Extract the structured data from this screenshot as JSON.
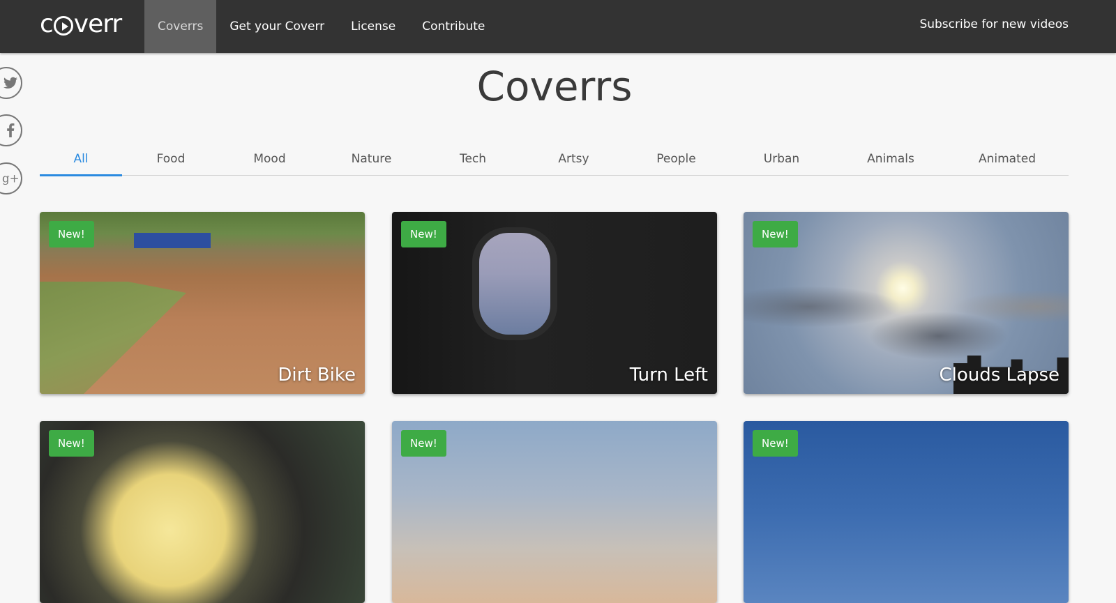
{
  "header": {
    "logo": "coverr",
    "nav": [
      "Coverrs",
      "Get your Coverr",
      "License",
      "Contribute"
    ],
    "active_nav": "Coverrs",
    "subscribe": "Subscribe for new videos"
  },
  "social": [
    "twitter-icon",
    "facebook-icon",
    "google-plus-icon"
  ],
  "page_title": "Coverrs",
  "tabs": [
    "All",
    "Food",
    "Mood",
    "Nature",
    "Tech",
    "Artsy",
    "People",
    "Urban",
    "Animals",
    "Animated"
  ],
  "active_tab": "All",
  "cards": [
    {
      "badge": "New!",
      "title": "Dirt Bike"
    },
    {
      "badge": "New!",
      "title": "Turn Left"
    },
    {
      "badge": "New!",
      "title": "Clouds Lapse"
    },
    {
      "badge": "New!",
      "title": ""
    },
    {
      "badge": "New!",
      "title": ""
    },
    {
      "badge": "New!",
      "title": ""
    }
  ],
  "colors": {
    "header_bg": "#333333",
    "active_nav_bg": "#5f5f5f",
    "accent_blue": "#2a8ae0",
    "badge_green": "#3eab45",
    "page_bg": "#f7f7f7"
  }
}
